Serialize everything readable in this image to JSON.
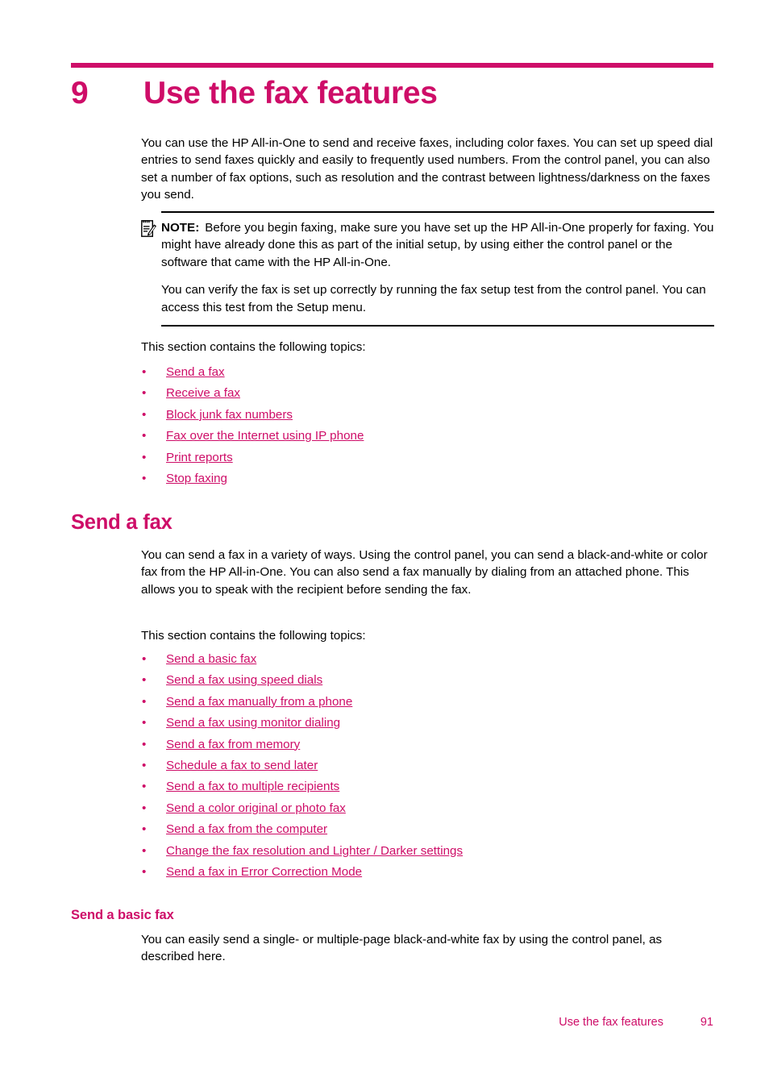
{
  "chapter": {
    "number": "9",
    "title": "Use the fax features"
  },
  "intro_paragraph": "You can use the HP All-in-One to send and receive faxes, including color faxes. You can set up speed dial entries to send faxes quickly and easily to frequently used numbers. From the control panel, you can also set a number of fax options, such as resolution and the contrast between lightness/darkness on the faxes you send.",
  "note": {
    "icon": "note-pencil-icon",
    "label": "NOTE:",
    "paragraph_1": "Before you begin faxing, make sure you have set up the HP All-in-One properly for faxing. You might have already done this as part of the initial setup, by using either the control panel or the software that came with the HP All-in-One.",
    "paragraph_2": "You can verify the fax is set up correctly by running the fax setup test from the control panel. You can access this test from the Setup menu."
  },
  "topics_intro_1": "This section contains the following topics:",
  "topics_1": [
    "Send a fax",
    "Receive a fax",
    "Block junk fax numbers",
    "Fax over the Internet using IP phone",
    "Print reports",
    "Stop faxing"
  ],
  "section_send_a_fax": {
    "heading": "Send a fax",
    "paragraph": "You can send a fax in a variety of ways. Using the control panel, you can send a black-and-white or color fax from the HP All-in-One. You can also send a fax manually by dialing from an attached phone. This allows you to speak with the recipient before sending the fax.",
    "topics_intro": "This section contains the following topics:",
    "topics": [
      "Send a basic fax",
      "Send a fax using speed dials",
      "Send a fax manually from a phone",
      "Send a fax using monitor dialing",
      "Send a fax from memory",
      "Schedule a fax to send later",
      "Send a fax to multiple recipients",
      "Send a color original or photo fax",
      "Send a fax from the computer",
      "Change the fax resolution and Lighter / Darker settings",
      "Send a fax in Error Correction Mode"
    ]
  },
  "section_send_a_basic_fax": {
    "heading": "Send a basic fax",
    "paragraph": "You can easily send a single- or multiple-page black-and-white fax by using the control panel, as described here."
  },
  "footer": {
    "title": "Use the fax features",
    "page_number": "91"
  },
  "bullet_glyph": "•",
  "colors": {
    "accent": "#CE0D68",
    "text": "#000000",
    "background": "#FFFFFF"
  }
}
